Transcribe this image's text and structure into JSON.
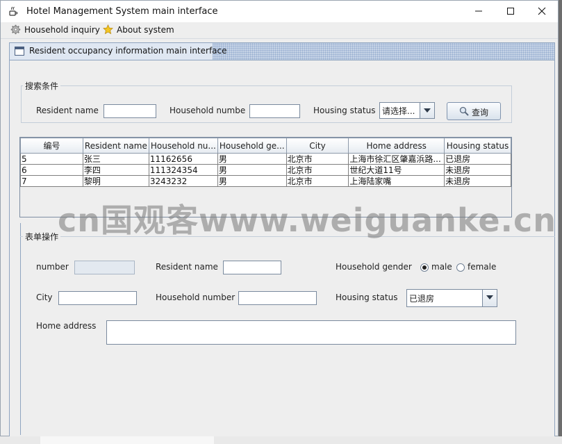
{
  "window": {
    "title": "Hotel Management System main interface",
    "minimize": "—",
    "maximize": "☐",
    "close": "✕"
  },
  "menu": {
    "items": [
      {
        "label": "Household inquiry",
        "icon": "gear-icon"
      },
      {
        "label": "About system",
        "icon": "star-icon"
      }
    ]
  },
  "internal_frame": {
    "title": "Resident occupancy information main interface"
  },
  "search": {
    "legend": "搜索条件",
    "resident_name_label": "Resident name",
    "resident_name_value": "",
    "household_number_label": "Household numbe",
    "household_number_value": "",
    "housing_status_label": "Housing status",
    "housing_status_value": "请选择...",
    "query_button": "查询"
  },
  "table": {
    "columns": [
      "编号",
      "Resident name",
      "Household nu...",
      "Household ge...",
      "City",
      "Home address",
      "Housing status"
    ],
    "rows": [
      [
        "5",
        "张三",
        "11162656",
        "男",
        "北京市",
        "上海市徐汇区肇嘉浜路...",
        "已退房"
      ],
      [
        "6",
        "李四",
        "111324354",
        "男",
        "北京市",
        "世纪大道11号",
        "未退房"
      ],
      [
        "7",
        "黎明",
        "3243232",
        "男",
        "北京市",
        "上海陆家嘴",
        "未退房"
      ]
    ]
  },
  "form": {
    "legend": "表单操作",
    "number_label": "number",
    "number_value": "",
    "resident_name_label": "Resident name",
    "resident_name_value": "",
    "household_gender_label": "Household gender",
    "gender_male": "male",
    "gender_female": "female",
    "gender_selected": "male",
    "city_label": "City",
    "city_value": "",
    "household_number_label": "Household number",
    "household_number_value": "",
    "housing_status_label": "Housing status",
    "housing_status_value": "已退房",
    "home_address_label": "Home address",
    "home_address_value": ""
  },
  "watermark": "cn国观客www.weiguanke.cn",
  "colors": {
    "frame_border": "#8fa4bf",
    "title_bar_dots": "#97aed0",
    "window_bg": "#eeeeee"
  }
}
